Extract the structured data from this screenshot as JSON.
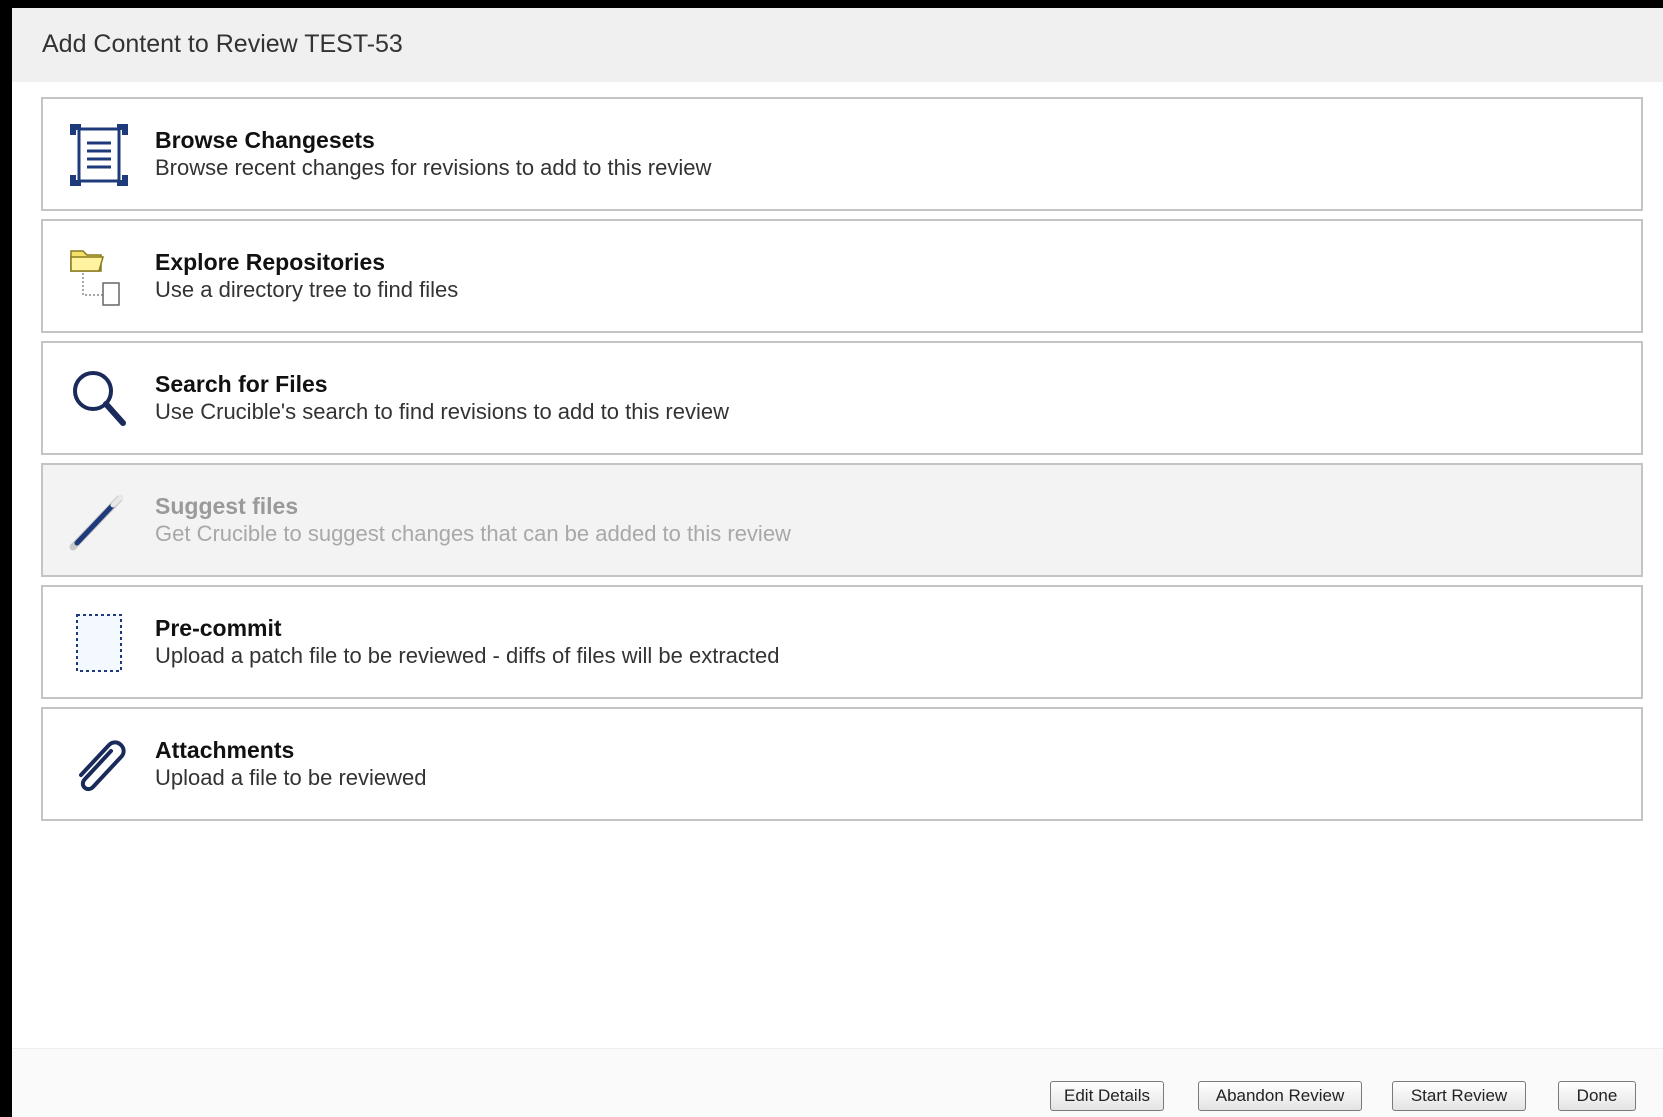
{
  "dialog": {
    "title": "Add Content to Review TEST-53"
  },
  "options": [
    {
      "icon": "changesets-icon",
      "title": "Browse Changesets",
      "description": "Browse recent changes for revisions to add to this review",
      "enabled": true
    },
    {
      "icon": "folder-tree-icon",
      "title": "Explore Repositories",
      "description": "Use a directory tree to find files",
      "enabled": true
    },
    {
      "icon": "magnifier-icon",
      "title": "Search for Files",
      "description": "Use Crucible's search to find revisions to add to this review",
      "enabled": true
    },
    {
      "icon": "magic-wand-icon",
      "title": "Suggest files",
      "description": "Get Crucible to suggest changes that can be added to this review",
      "enabled": false
    },
    {
      "icon": "patch-file-icon",
      "title": "Pre-commit",
      "description": "Upload a patch file to be reviewed - diffs of files will be extracted",
      "enabled": true
    },
    {
      "icon": "paperclip-icon",
      "title": "Attachments",
      "description": "Upload a file to be reviewed",
      "enabled": true
    }
  ],
  "footer": {
    "edit_details": "Edit Details",
    "abandon_review": "Abandon Review",
    "start_review": "Start Review",
    "done": "Done"
  }
}
